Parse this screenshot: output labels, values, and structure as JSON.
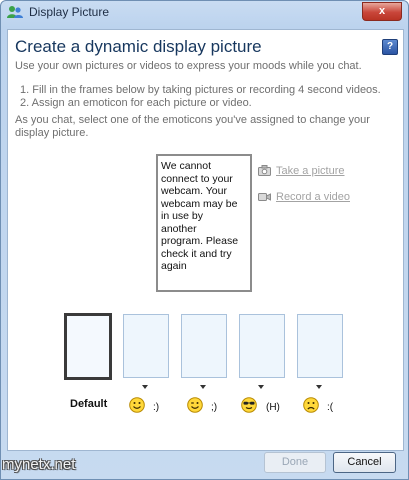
{
  "window": {
    "title": "Display Picture",
    "close_glyph": "x"
  },
  "help": {
    "glyph": "?"
  },
  "main": {
    "heading": "Create a dynamic display picture",
    "intro": "Use your own pictures or videos to express your moods while you chat.",
    "steps": [
      "1. Fill in the frames below by taking pictures or recording 4 second videos.",
      "2. Assign an emoticon for each picture or video."
    ],
    "footer_text_line1": "As you chat, select one of the emoticons you've assigned to change your",
    "footer_text_line2": "display picture."
  },
  "webcam_notice": {
    "lines": [
      "We cannot",
      "connect to your",
      "webcam. Your",
      "webcam may be",
      "in use by",
      "another",
      "program. Please",
      "check it and try",
      "again"
    ]
  },
  "actions": {
    "take_picture": "Take a picture",
    "record_video": "Record a video",
    "camera_icon": "camera-icon",
    "video_icon": "video-camera-icon"
  },
  "slots": {
    "default_label": "Default",
    "emoticons": [
      {
        "icon": "smile-emoticon-icon",
        "code": ":)"
      },
      {
        "icon": "wink-emoticon-icon",
        "code": ";)"
      },
      {
        "icon": "cool-sunglasses-emoticon-icon",
        "code": "(H)"
      },
      {
        "icon": "sad-emoticon-icon",
        "code": ":("
      }
    ]
  },
  "buttons": {
    "done": "Done",
    "cancel": "Cancel"
  },
  "watermark": "mynetx.net",
  "colors": {
    "frame_blue": "#bcd3ee",
    "heading_blue": "#17375e",
    "close_red": "#c9463a"
  }
}
